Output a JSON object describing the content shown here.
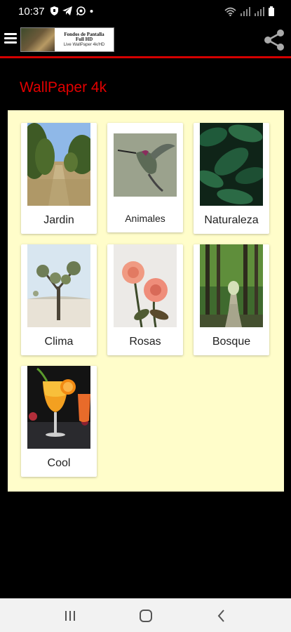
{
  "status_bar": {
    "time": "10:37"
  },
  "header": {
    "logo_line1": "Fondos de Pantalla",
    "logo_line2": "Full HD",
    "logo_line3": "Live WallPaper 4k/HD"
  },
  "page": {
    "title": "WallPaper 4k"
  },
  "categories": [
    {
      "label": "Jardin",
      "icon": "garden-photo"
    },
    {
      "label": "Animales",
      "icon": "hummingbird-photo"
    },
    {
      "label": "Naturaleza",
      "icon": "leaves-photo"
    },
    {
      "label": "Clima",
      "icon": "desert-tree-photo"
    },
    {
      "label": "Rosas",
      "icon": "roses-photo"
    },
    {
      "label": "Bosque",
      "icon": "forest-photo"
    },
    {
      "label": "Cool",
      "icon": "cocktail-photo"
    }
  ],
  "colors": {
    "accent": "#e00000",
    "panel": "#fffdca"
  }
}
